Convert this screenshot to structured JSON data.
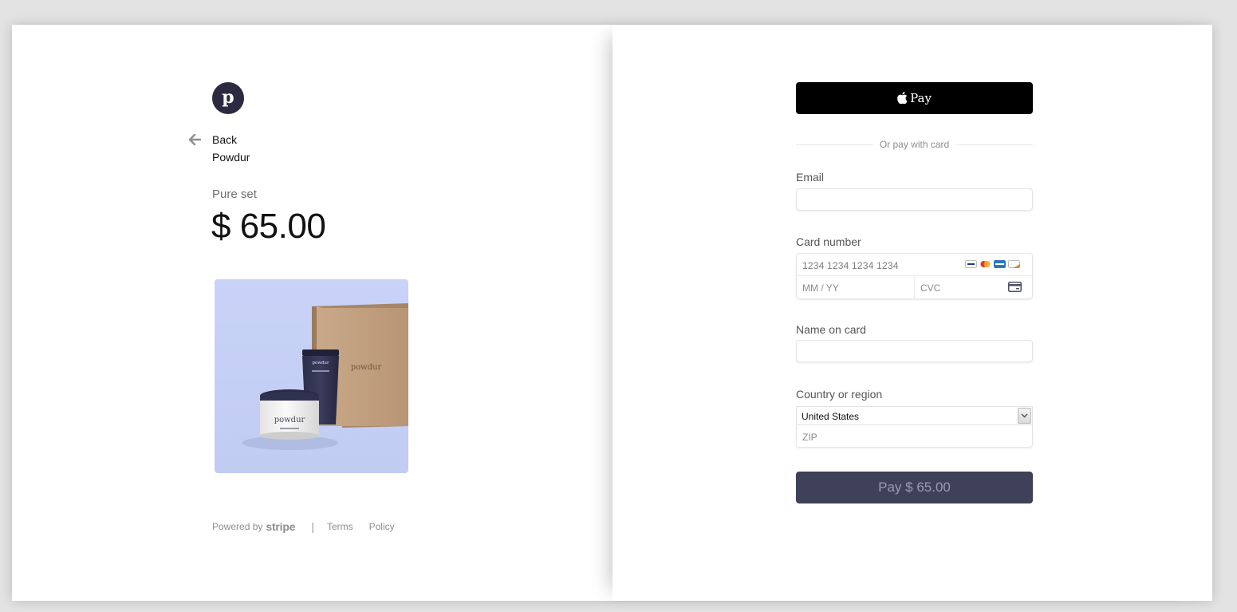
{
  "merchant": {
    "logo_letter": "p",
    "back_label": "Back",
    "name": "Powdur"
  },
  "product": {
    "name": "Pure set",
    "price": "$ 65.00",
    "box_brand": "powdur",
    "tube_brand": "powdur",
    "jar_brand": "powdur"
  },
  "footer": {
    "powered_by": "Powered by",
    "stripe": "stripe",
    "separator": "|",
    "terms": "Terms",
    "policy": "Policy"
  },
  "payment": {
    "apple_pay_label": "Pay",
    "divider_text": "Or pay with card",
    "email_label": "Email",
    "card_label": "Card number",
    "card_placeholder": "1234 1234 1234 1234",
    "expiry_placeholder": "MM / YY",
    "cvc_placeholder": "CVC",
    "name_label": "Name on card",
    "country_label": "Country or region",
    "country_value": "United States",
    "zip_placeholder": "ZIP",
    "pay_button": "Pay $ 65.00",
    "card_brands": [
      "visa-icon",
      "mastercard-icon",
      "amex-icon",
      "discover-icon"
    ]
  },
  "colors": {
    "logo_bg": "#2b2a40",
    "pay_button_bg": "#3f4159",
    "product_bg": "#c7d2f7"
  }
}
